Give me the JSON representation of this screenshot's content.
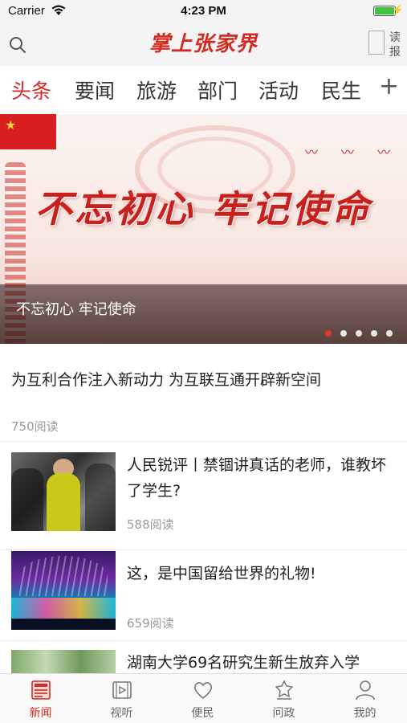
{
  "status_bar": {
    "carrier": "Carrier",
    "time": "4:23 PM"
  },
  "header": {
    "app_title": "掌上张家界",
    "read_paper_line1": "读",
    "read_paper_line2": "报"
  },
  "tabs": {
    "items": [
      {
        "label": "头条",
        "active": true
      },
      {
        "label": "要闻",
        "active": false
      },
      {
        "label": "旅游",
        "active": false
      },
      {
        "label": "部门",
        "active": false
      },
      {
        "label": "活动",
        "active": false
      },
      {
        "label": "民生",
        "active": false
      }
    ],
    "add_label": "+"
  },
  "banner": {
    "slogan": "不忘初心 牢记使命",
    "caption": "不忘初心 牢记使命",
    "slide_count": 5,
    "active_slide": 1
  },
  "lead_article": {
    "title": "为互利合作注入新动力 为互联互通开辟新空间",
    "reads": "750阅读"
  },
  "news": [
    {
      "title": "人民锐评丨禁锢讲真话的老师，谁教坏了学生?",
      "reads": "588阅读"
    },
    {
      "title": "这，是中国留给世界的礼物!",
      "reads": "659阅读"
    },
    {
      "title": "湖南大学69名研究生新生放弃入学",
      "reads": ""
    }
  ],
  "tabbar": {
    "items": [
      {
        "label": "新闻",
        "icon": "news-icon",
        "active": true
      },
      {
        "label": "视听",
        "icon": "video-icon",
        "active": false
      },
      {
        "label": "便民",
        "icon": "heart-icon",
        "active": false
      },
      {
        "label": "问政",
        "icon": "government-icon",
        "active": false
      },
      {
        "label": "我的",
        "icon": "profile-icon",
        "active": false
      }
    ]
  },
  "colors": {
    "accent": "#d32a22",
    "muted": "#999999"
  }
}
